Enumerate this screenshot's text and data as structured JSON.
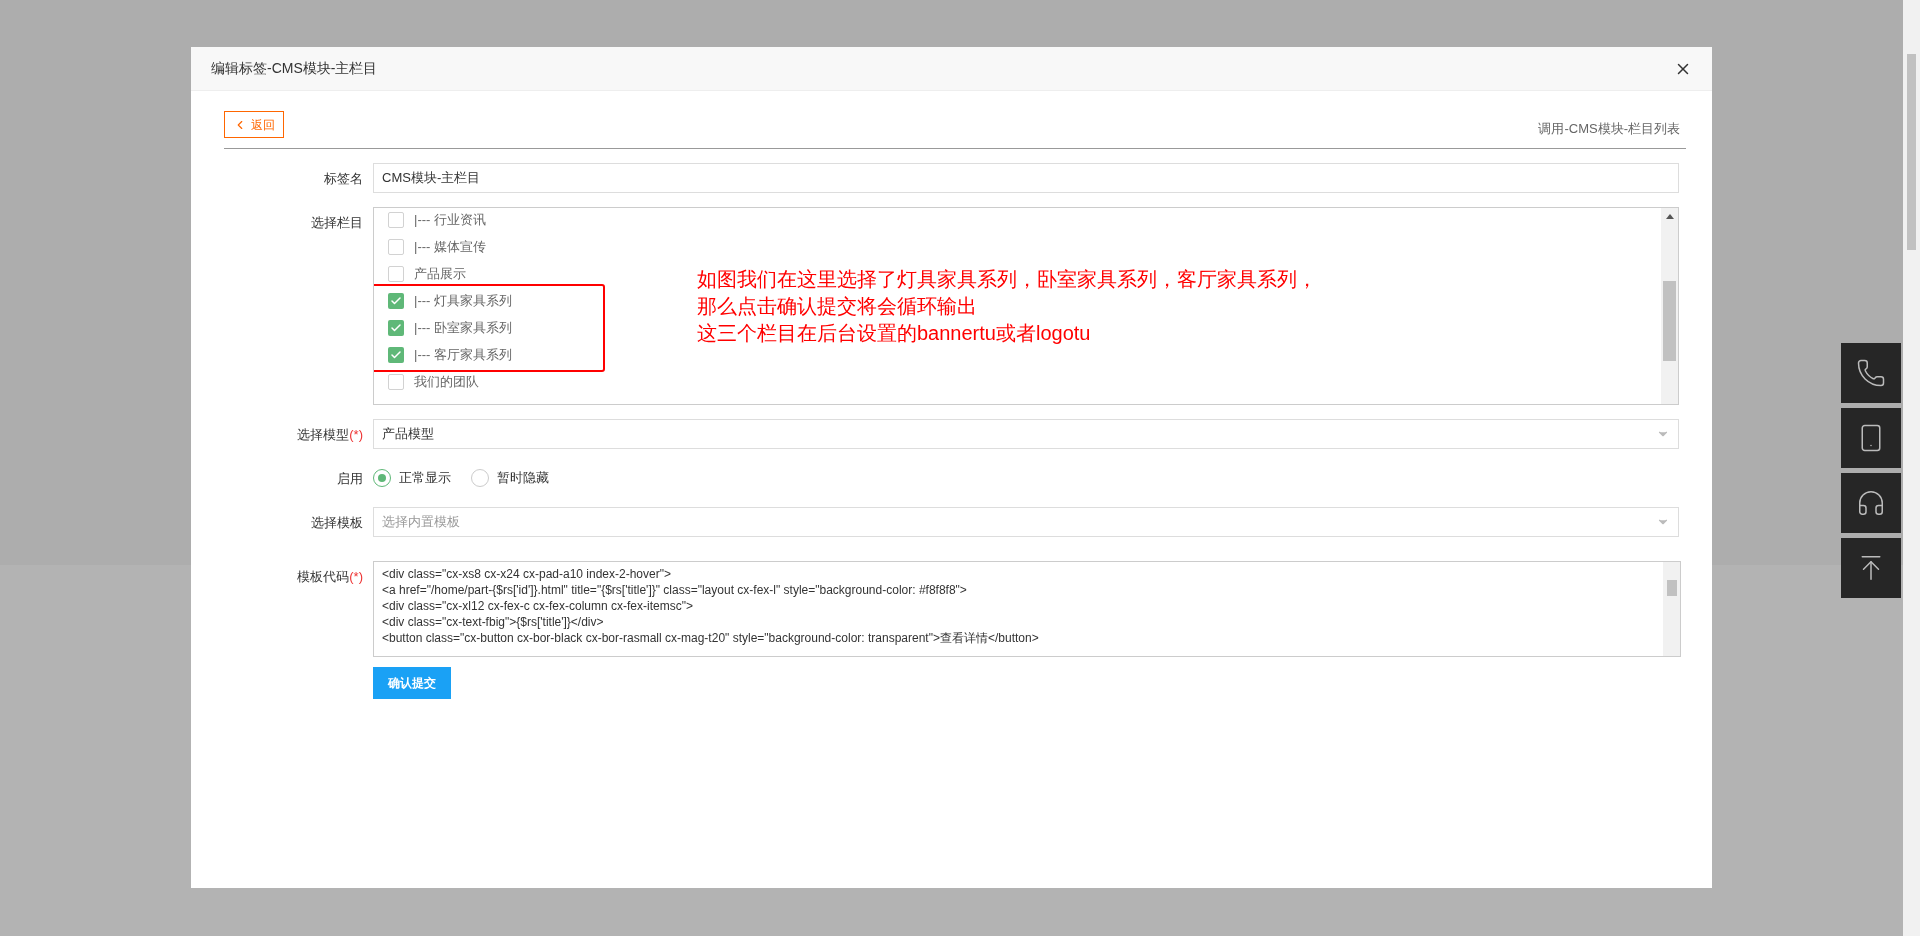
{
  "dialog": {
    "title": "编辑标签-CMS模块-主栏目",
    "back_button": "返回",
    "link": "调用-CMS模块-栏目列表"
  },
  "form": {
    "tag_name": {
      "label": "标签名",
      "value": "CMS模块-主栏目"
    },
    "columns": {
      "label": "选择栏目",
      "items": [
        {
          "label": "|--- 行业资讯",
          "checked": false
        },
        {
          "label": "|--- 媒体宣传",
          "checked": false
        },
        {
          "label": "产品展示",
          "checked": false
        },
        {
          "label": "|--- 灯具家具系列",
          "checked": true
        },
        {
          "label": "|--- 卧室家具系列",
          "checked": true
        },
        {
          "label": "|--- 客厅家具系列",
          "checked": true
        },
        {
          "label": "我们的团队",
          "checked": false
        }
      ]
    },
    "model": {
      "label": "选择模型",
      "required": "(*)",
      "value": "产品模型"
    },
    "enabled": {
      "label": "启用",
      "options": [
        {
          "label": "正常显示",
          "selected": true
        },
        {
          "label": "暂时隐藏",
          "selected": false
        }
      ]
    },
    "template": {
      "label": "选择模板",
      "placeholder": "选择内置模板"
    },
    "code": {
      "label": "模板代码",
      "required": "(*)",
      "lines": [
        "<div class=\"cx-xs8 cx-x24 cx-pad-a10 index-2-hover\">",
        "<a href=\"/home/part-{$rs['id']}.html\" title=\"{$rs['title']}\" class=\"layout cx-fex-l\" style=\"background-color: #f8f8f8\">",
        "<div class=\"cx-xl12 cx-fex-c cx-fex-column cx-fex-itemsc\">",
        "<div class=\"cx-text-fbig\">{$rs['title']}</div>",
        "<button class=\"cx-button cx-bor-black cx-bor-rasmall cx-mag-t20\" style=\"background-color: transparent\">查看详情</button>"
      ]
    },
    "submit": "确认提交"
  },
  "annotation": {
    "lines": [
      "如图我们在这里选择了灯具家具系列，卧室家具系列，客厅家具系列，",
      "那么点击确认提交将会循环输出",
      "这三个栏目在后台设置的bannertu或者logotu"
    ]
  }
}
